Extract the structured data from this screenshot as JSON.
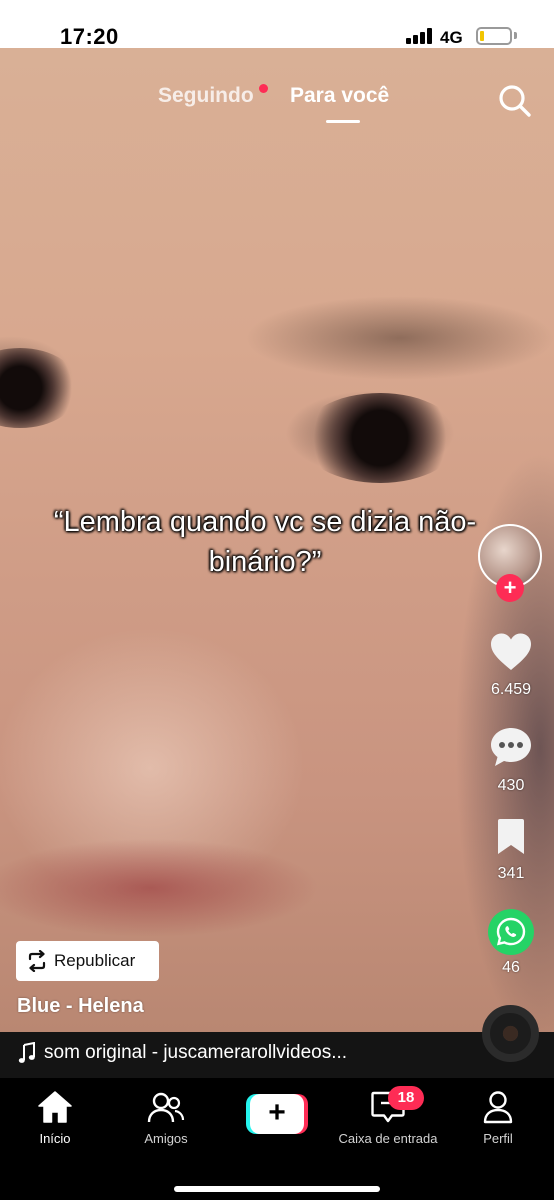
{
  "status_bar": {
    "time": "17:20",
    "network": "4G"
  },
  "header": {
    "tab_following": "Seguindo",
    "tab_for_you": "Para você",
    "active_tab": "Para você"
  },
  "video": {
    "caption": "“Lembra quando vc se dizia não-binário?”"
  },
  "actions": {
    "likes": "6.459",
    "comments": "430",
    "saves": "341",
    "shares": "46"
  },
  "post": {
    "repost_label": "Republicar",
    "author_line": "Blue - Helena",
    "sound": "som original - juscamerarollvideos..."
  },
  "nav": {
    "home": "Início",
    "friends": "Amigos",
    "inbox": "Caixa de entrada",
    "inbox_badge": "18",
    "profile": "Perfil"
  },
  "colors": {
    "accent": "#fe2c55",
    "cyan": "#25f4ee",
    "whatsapp": "#25d366"
  },
  "icons": [
    "search-icon",
    "heart-icon",
    "comment-icon",
    "bookmark-icon",
    "whatsapp-icon",
    "repost-icon",
    "music-note-icon",
    "home-icon",
    "friends-icon",
    "plus-icon",
    "inbox-icon",
    "profile-icon"
  ]
}
